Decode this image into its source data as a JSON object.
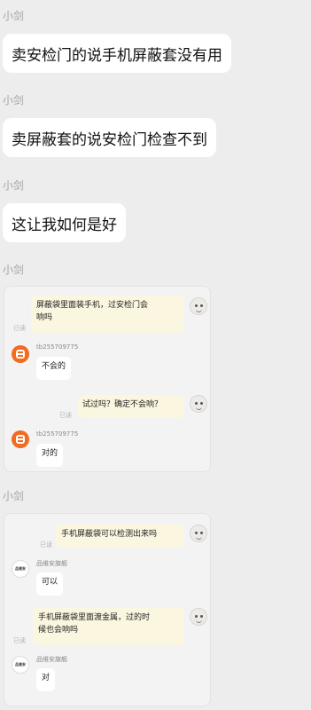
{
  "messages": [
    {
      "sender": "小剑",
      "text": "卖安检门的说手机屏蔽套没有用"
    },
    {
      "sender": "小剑",
      "text": "卖屏蔽套的说安检门检查不到"
    },
    {
      "sender": "小剑",
      "text": "这让我如何是好"
    },
    {
      "sender": "小剑"
    },
    {
      "sender": "小剑"
    }
  ],
  "screenshot1": {
    "msg1": "屏蔽袋里面装手机，过安检门会",
    "msg1b": "响吗",
    "read": "已读",
    "seller_name": "tb255709775",
    "reply1": "不会的",
    "msg2": "试过吗？确定不会响？",
    "read2": "已读",
    "reply2": "对的"
  },
  "screenshot2": {
    "msg1": "手机屏蔽袋可以检测出来吗",
    "read": "已读",
    "seller_name": "品维安旗舰",
    "reply1": "可以",
    "msg2": "手机屏蔽袋里面渡金属，过的时",
    "msg2b": "候也会响吗",
    "read2": "已读",
    "reply2": "对",
    "shop_logo": "品维安"
  }
}
